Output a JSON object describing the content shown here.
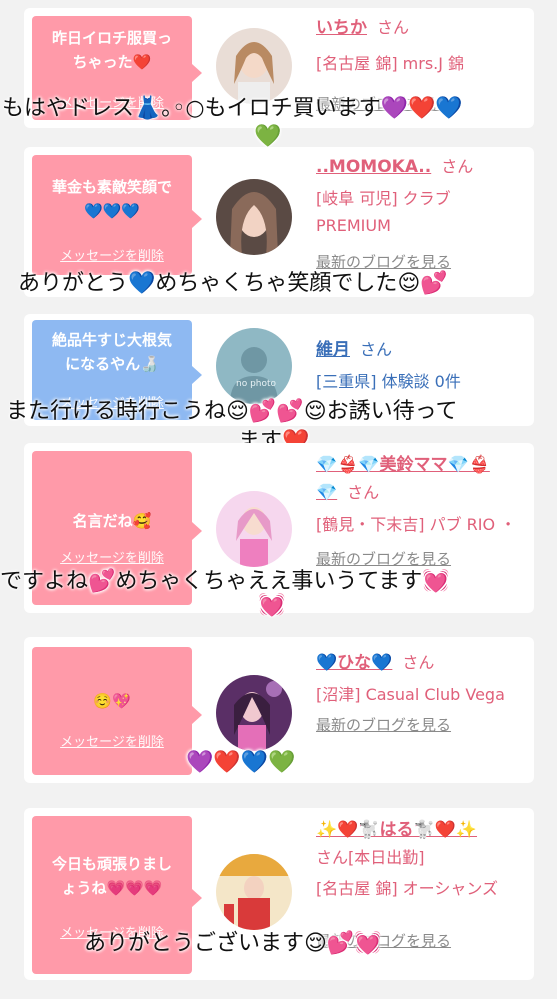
{
  "colors": {
    "bubble_pink": "#ff9aa9",
    "bubble_blue": "#8eb9f2",
    "name_pink": "#e0607a",
    "name_blue": "#3a6fb8",
    "link_gray": "#8a8a8a"
  },
  "delete_label": "メッセージを削除",
  "blog_label": "最新のブログを見る",
  "cards": [
    {
      "bubble_lines": [
        "昨日イロチ服買っ",
        "ちゃった❤️"
      ],
      "name": "いちか",
      "san": "さん",
      "shop": "[名古屋 錦] mrs.J 錦",
      "overlay": "もはやドレス👗｡◦○もイロチ買います💜❤️💙",
      "overlay2": "💚"
    },
    {
      "bubble_lines": [
        "華金も素敵笑顔で",
        "💙💙💙"
      ],
      "name": "..MOMOKA..",
      "san": "さん",
      "shop": "[岐阜 可児] クラブ PREMIUM",
      "overlay": "ありがとう💙めちゃくちゃ笑顔でした😌💕"
    },
    {
      "bubble_lines": [
        "絶品牛すじ大根気",
        "になるやん🍶"
      ],
      "name": "維月",
      "san": "さん",
      "shop": "[三重県] 体験談 0件",
      "avatar_text": "no photo",
      "overlay": "また行ける時行こうね😌💕💕😌お誘い待って",
      "overlay2": "ます❤️"
    },
    {
      "bubble_lines": [
        "名言だね🥰"
      ],
      "name": "💎👙💎美鈴ママ💎👙",
      "name2": "💎",
      "san": "さん",
      "shop": "[鶴見・下末吉] パブ RIO ・",
      "overlay": "ですよね💕めちゃくちゃええ事いうてます💓",
      "overlay2": "💓"
    },
    {
      "bubble_lines": [
        "☺️💖"
      ],
      "name": "💙ひな💙",
      "san": "さん",
      "shop": "[沼津] Casual Club Vega",
      "overlay": "💜❤️💙💚"
    },
    {
      "bubble_lines": [
        "今日も頑張りまし",
        "ょうね💗💗💗"
      ],
      "name": "✨❤️🐩はる🐩❤️✨",
      "san": "さん[本日出勤]",
      "shop": "[名古屋 錦] オーシャンズ",
      "overlay": "ありがとうございます😌💕💓"
    }
  ]
}
